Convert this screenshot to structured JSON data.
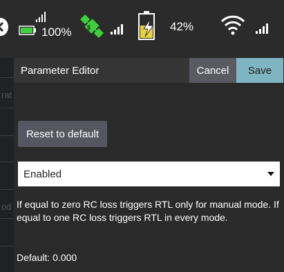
{
  "status_bar": {
    "battery_1_percent": "100%",
    "battery_2_percent": "42%",
    "icons": [
      "chevron-left-icon",
      "signal-icon",
      "battery-icon",
      "satellite-icon",
      "signal-icon",
      "battery-icon",
      "wifi-icon",
      "signal-icon"
    ],
    "colors": {
      "battery_green": "#3fd13f",
      "satellite_green": "#3cd13c",
      "battery_yellow": "#e8d23a"
    }
  },
  "background_page": {
    "fragments": [
      "rat",
      "od"
    ]
  },
  "dialog": {
    "title": "Parameter Editor",
    "cancel_label": "Cancel",
    "save_label": "Save",
    "reset_label": "Reset to default",
    "selected_value": "Enabled",
    "description": "If equal to zero RC loss triggers RTL only for manual mode. If equal to one RC loss triggers RTL in every mode.",
    "default_label": "Default: 0.000",
    "colors": {
      "save": "#7fb5c3",
      "cancel": "#5a5a63",
      "reset": "#55565f"
    }
  }
}
